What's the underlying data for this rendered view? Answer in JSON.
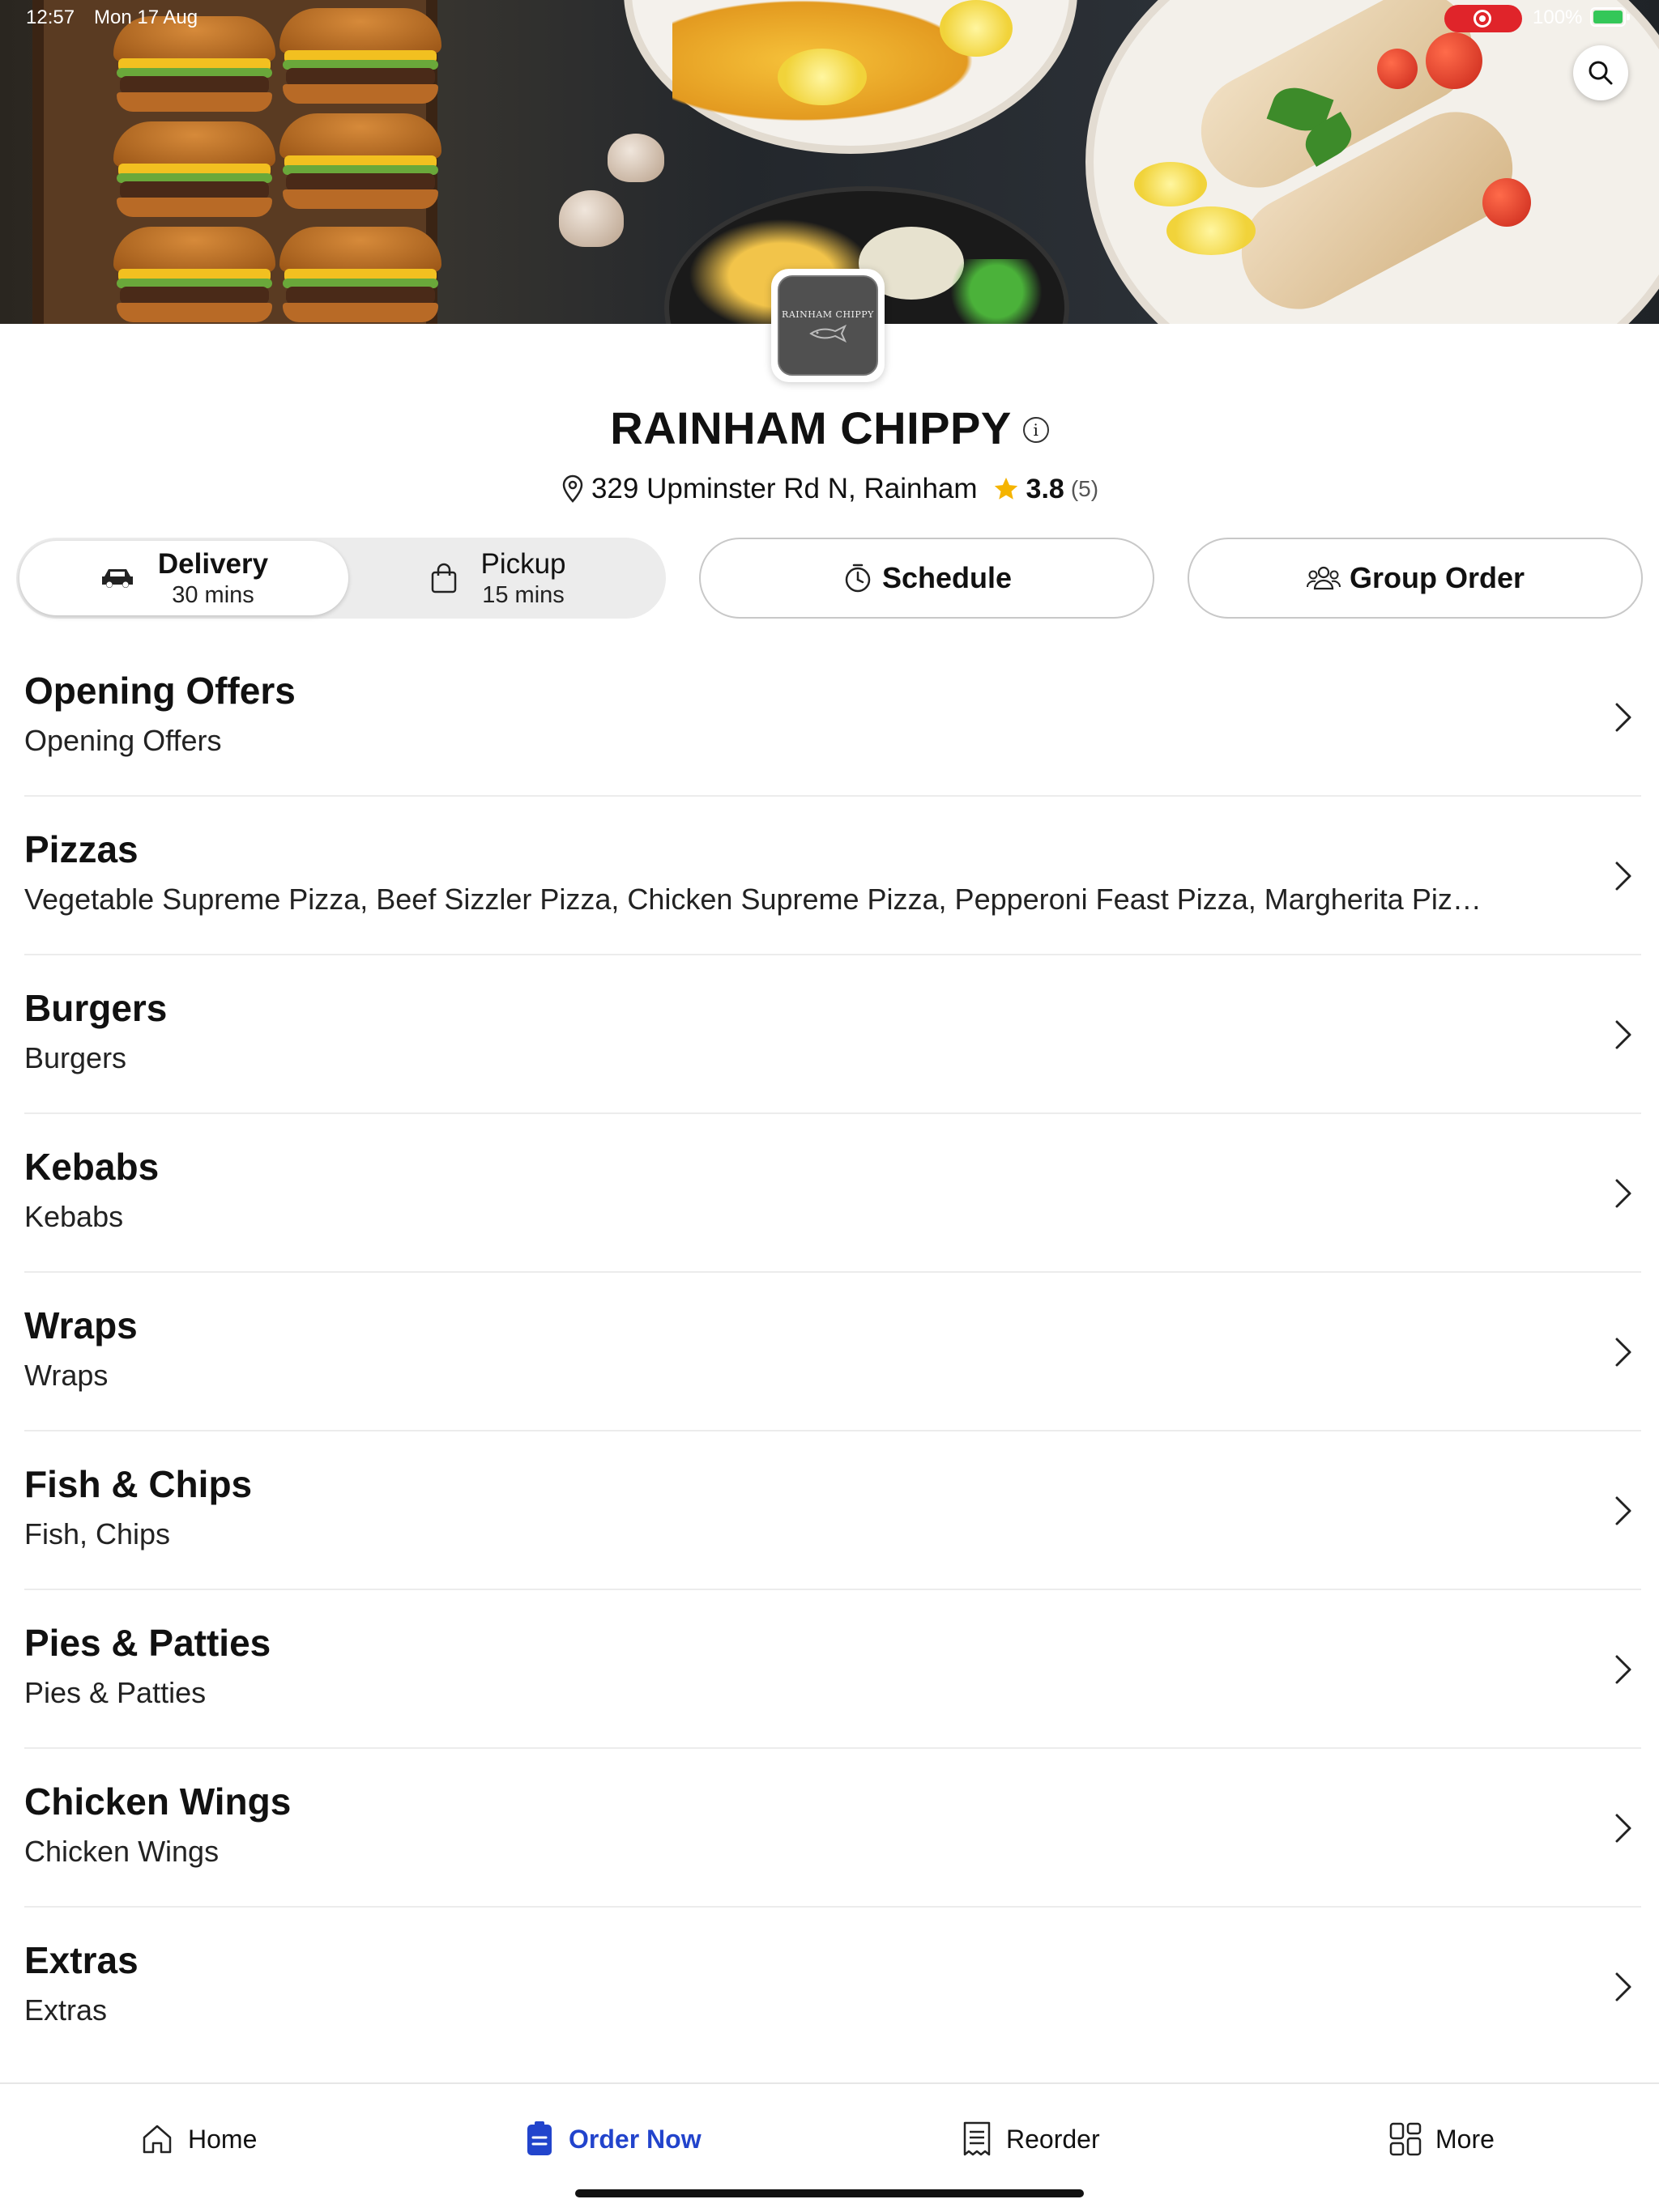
{
  "status_bar": {
    "time": "12:57",
    "date": "Mon 17 Aug",
    "battery": "100%",
    "battery_level": 1.0
  },
  "restaurant": {
    "name": "RAINHAM CHIPPY",
    "logo_text": "RAINHAM CHIPPY",
    "address": "329 Upminster Rd N, Rainham",
    "rating": "3.8",
    "rating_count": "(5)"
  },
  "order_mode": {
    "delivery": {
      "label": "Delivery",
      "time": "30 mins",
      "selected": true
    },
    "pickup": {
      "label": "Pickup",
      "time": "15 mins",
      "selected": false
    },
    "schedule_label": "Schedule",
    "group_order_label": "Group Order"
  },
  "categories": [
    {
      "name": "Opening Offers",
      "items": "Opening Offers"
    },
    {
      "name": "Pizzas",
      "items": "Vegetable Supreme Pizza, Beef Sizzler Pizza, Chicken Supreme Pizza, Pepperoni Feast Pizza, Margherita Piz…"
    },
    {
      "name": "Burgers",
      "items": "Burgers"
    },
    {
      "name": "Kebabs",
      "items": "Kebabs"
    },
    {
      "name": "Wraps",
      "items": "Wraps"
    },
    {
      "name": "Fish & Chips",
      "items": "Fish, Chips"
    },
    {
      "name": "Pies & Patties",
      "items": "Pies & Patties"
    },
    {
      "name": "Chicken Wings",
      "items": "Chicken Wings"
    },
    {
      "name": "Extras",
      "items": "Extras"
    }
  ],
  "tabbar": {
    "home": "Home",
    "order_now": "Order Now",
    "reorder": "Reorder",
    "more": "More"
  },
  "colors": {
    "accent": "#2244cc",
    "star": "#f5b400",
    "record": "#e0242a",
    "battery": "#34c759"
  },
  "icons": [
    "search-icon",
    "info-icon",
    "location-pin-icon",
    "star-icon",
    "car-icon",
    "shopping-bag-icon",
    "timer-icon",
    "group-icon",
    "chevron-right-icon",
    "home-icon",
    "order-icon",
    "receipt-icon",
    "grid-icon"
  ]
}
